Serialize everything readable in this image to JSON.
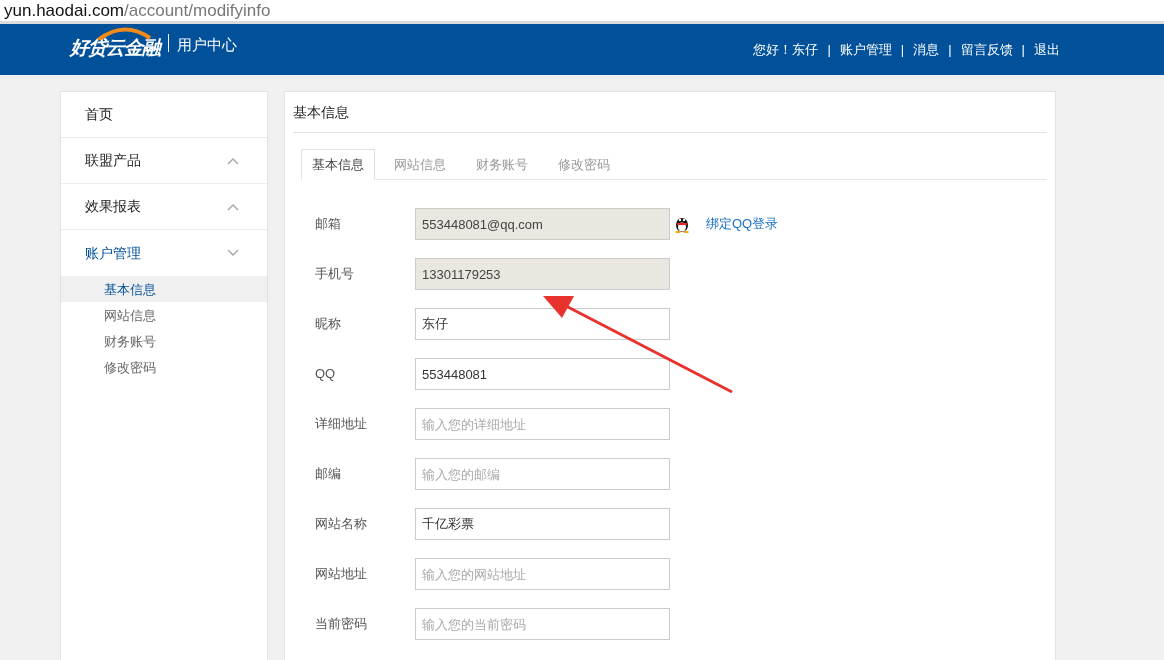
{
  "address_bar": {
    "host": "yun.haodai.com",
    "path": "/account/modifyinfo"
  },
  "header": {
    "logo": "好贷云金融",
    "section": "用户中心",
    "links": [
      {
        "label": "您好！东仔"
      },
      {
        "label": "账户管理"
      },
      {
        "label": "消息"
      },
      {
        "label": "留言反馈"
      },
      {
        "label": "退出"
      }
    ],
    "separator": "|"
  },
  "sidebar": {
    "items": [
      {
        "label": "首页",
        "kind": "link"
      },
      {
        "label": "联盟产品",
        "kind": "group",
        "expanded": false
      },
      {
        "label": "效果报表",
        "kind": "group",
        "expanded": false
      },
      {
        "label": "账户管理",
        "kind": "group",
        "expanded": true,
        "children": [
          {
            "label": "基本信息",
            "selected": true
          },
          {
            "label": "网站信息",
            "selected": false
          },
          {
            "label": "财务账号",
            "selected": false
          },
          {
            "label": "修改密码",
            "selected": false
          }
        ]
      }
    ]
  },
  "panel": {
    "title": "基本信息",
    "tabs": [
      {
        "label": "基本信息",
        "selected": true
      },
      {
        "label": "网站信息",
        "selected": false
      },
      {
        "label": "财务账号",
        "selected": false
      },
      {
        "label": "修改密码",
        "selected": false
      }
    ],
    "fields": [
      {
        "label": "邮箱",
        "value": "553448081@qq.com",
        "disabled": true,
        "link": "绑定QQ登录"
      },
      {
        "label": "手机号",
        "value": "13301179253",
        "disabled": true
      },
      {
        "label": "昵称",
        "value": "东仔",
        "disabled": false
      },
      {
        "label": "QQ",
        "value": "553448081",
        "disabled": false
      },
      {
        "label": "详细地址",
        "placeholder": "输入您的详细地址",
        "disabled": false
      },
      {
        "label": "邮编",
        "placeholder": "输入您的邮编",
        "disabled": false
      },
      {
        "label": "网站名称",
        "value": "千亿彩票",
        "disabled": false
      },
      {
        "label": "网站地址",
        "placeholder": "输入您的网站地址",
        "disabled": false
      },
      {
        "label": "当前密码",
        "placeholder": "输入您的当前密码",
        "disabled": false
      }
    ]
  }
}
